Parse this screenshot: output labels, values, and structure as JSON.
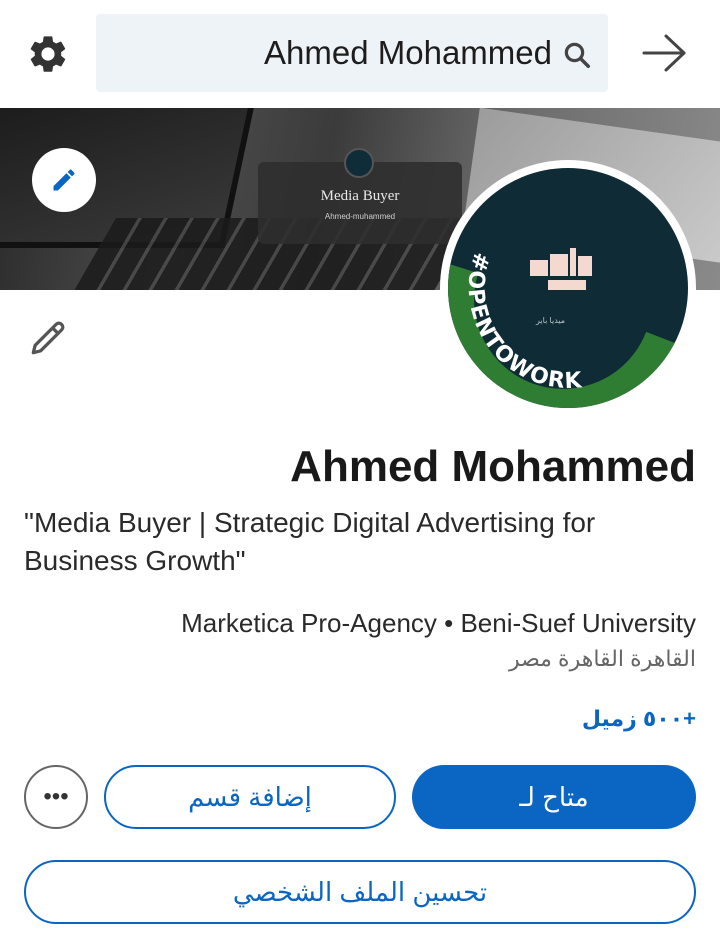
{
  "search": {
    "value": "Ahmed Mohammed",
    "icon": "search-icon"
  },
  "topbar": {
    "settings_icon": "gear-icon",
    "forward_icon": "arrow-right-icon"
  },
  "banner": {
    "card_title": "Media Buyer",
    "card_subtitle": "Ahmed-muhammed",
    "edit_icon": "pencil-icon"
  },
  "photo": {
    "frame_text": "#OPENTOWORK",
    "frame_color": "#2f7d32"
  },
  "profile": {
    "name": "Ahmed Mohammed",
    "headline": "\"Media Buyer | Strategic Digital Advertising for Business Growth\"",
    "organization": "Marketica Pro-Agency • Beni-Suef University",
    "location": "القاهرة القاهرة مصر",
    "connections": "+٥٠٠ زميل"
  },
  "actions": {
    "available_label": "متاح لـ",
    "add_section_label": "إضافة قسم",
    "more_label": "•••",
    "improve_profile_label": "تحسين الملف الشخصي"
  },
  "colors": {
    "accent": "#0a66c2",
    "search_bg": "#eef3f8"
  }
}
